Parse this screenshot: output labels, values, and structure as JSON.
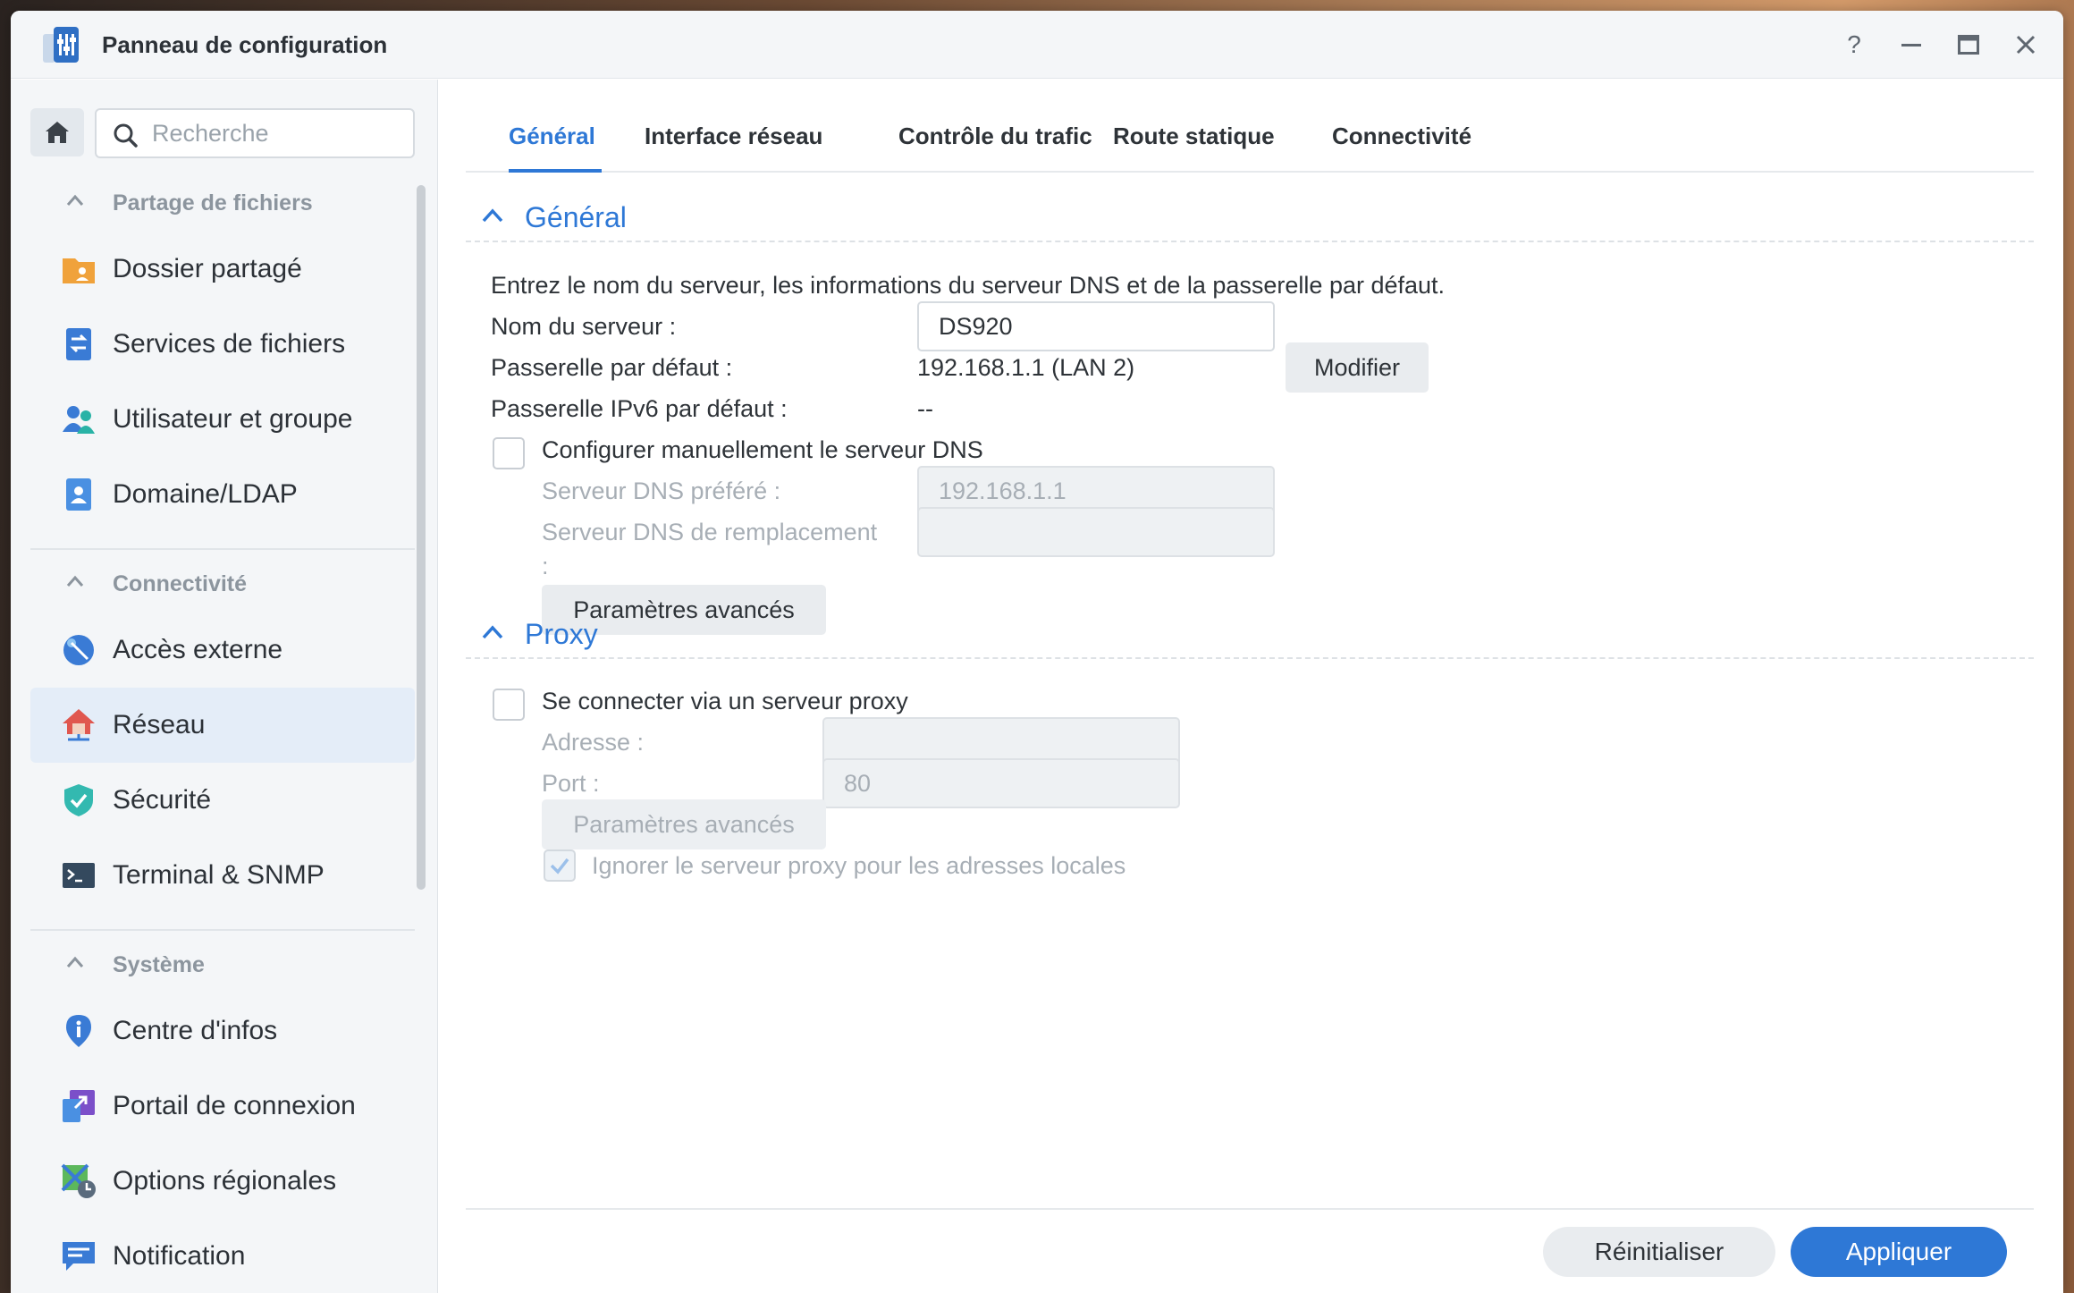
{
  "window": {
    "title": "Panneau de configuration"
  },
  "titlebar_buttons": {
    "help": "?"
  },
  "sidebar": {
    "search_placeholder": "Recherche",
    "sections": [
      {
        "label": "Partage de fichiers",
        "items": [
          {
            "label": "Dossier partagé",
            "icon": "shared-folder-icon"
          },
          {
            "label": "Services de fichiers",
            "icon": "file-services-icon"
          },
          {
            "label": "Utilisateur et groupe",
            "icon": "users-icon"
          },
          {
            "label": "Domaine/LDAP",
            "icon": "domain-icon"
          }
        ]
      },
      {
        "label": "Connectivité",
        "items": [
          {
            "label": "Accès externe",
            "icon": "external-access-icon"
          },
          {
            "label": "Réseau",
            "icon": "network-house-icon",
            "active": true
          },
          {
            "label": "Sécurité",
            "icon": "shield-icon"
          },
          {
            "label": "Terminal & SNMP",
            "icon": "terminal-icon"
          }
        ]
      },
      {
        "label": "Système",
        "items": [
          {
            "label": "Centre d'infos",
            "icon": "info-icon"
          },
          {
            "label": "Portail de connexion",
            "icon": "login-portal-icon"
          },
          {
            "label": "Options régionales",
            "icon": "regional-options-icon"
          },
          {
            "label": "Notification",
            "icon": "notification-icon"
          }
        ]
      }
    ]
  },
  "tabs": [
    "Général",
    "Interface réseau",
    "Contrôle du trafic",
    "Route statique",
    "Connectivité"
  ],
  "general": {
    "header": "Général",
    "description": "Entrez le nom du serveur, les informations du serveur DNS et de la passerelle par défaut.",
    "server_name_label": "Nom du serveur :",
    "server_name_value": "DS920",
    "gateway_label": "Passerelle par défaut :",
    "gateway_value": "192.168.1.1 (LAN 2)",
    "modify_button": "Modifier",
    "ipv6_gateway_label": "Passerelle IPv6 par défaut :",
    "ipv6_gateway_value": "--",
    "manual_dns_label": "Configurer manuellement le serveur DNS",
    "manual_dns_checked": false,
    "preferred_dns_label": "Serveur DNS préféré :",
    "preferred_dns_value": "192.168.1.1",
    "alternate_dns_label_line1": "Serveur DNS de remplacement",
    "alternate_dns_label_line2": ":",
    "alternate_dns_value": "",
    "advanced_button": "Paramètres avancés"
  },
  "proxy": {
    "header": "Proxy",
    "connect_label": "Se connecter via un serveur proxy",
    "connect_checked": false,
    "address_label": "Adresse :",
    "address_value": "",
    "port_label": "Port :",
    "port_value": "80",
    "advanced_button": "Paramètres avancés",
    "bypass_label": "Ignorer le serveur proxy pour les adresses locales",
    "bypass_checked": true
  },
  "footer": {
    "reset_button": "Réinitialiser",
    "apply_button": "Appliquer"
  },
  "colors": {
    "accent": "#2e78d6",
    "active_nav_bg": "#e4edf8"
  }
}
